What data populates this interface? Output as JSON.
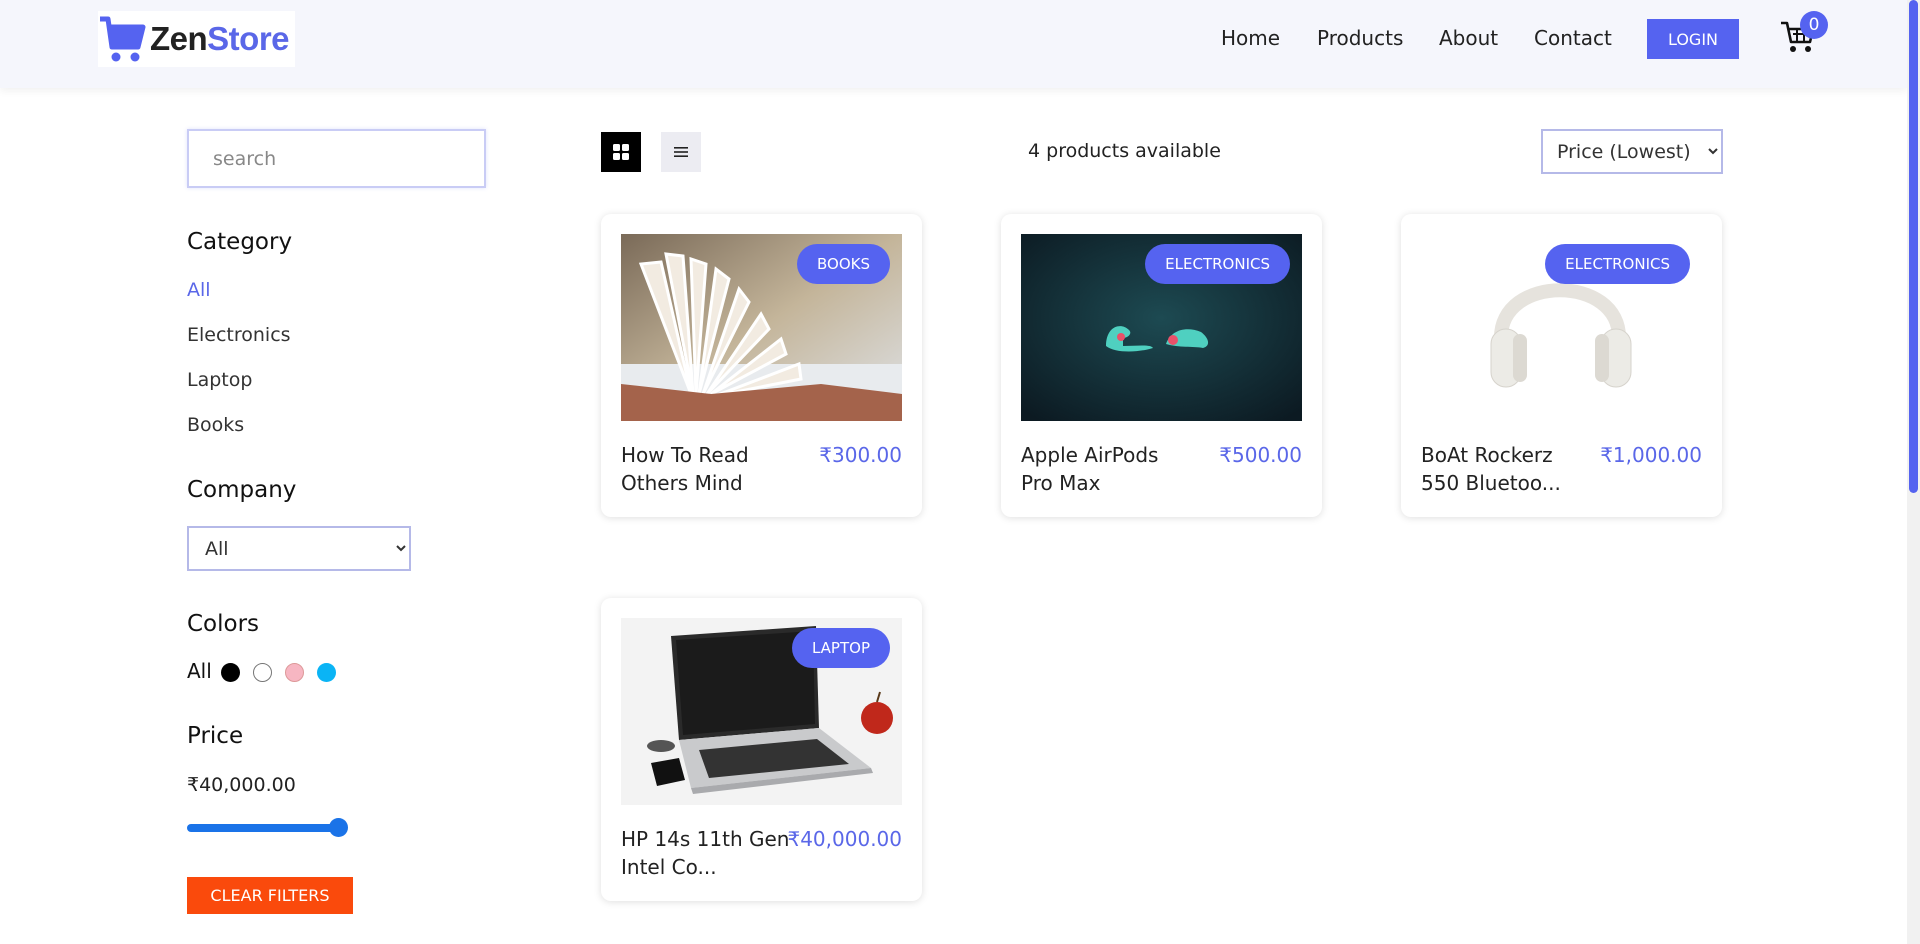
{
  "brand": {
    "name_part1": "Zen",
    "name_part2": "Store"
  },
  "nav": {
    "home": "Home",
    "products": "Products",
    "about": "About",
    "contact": "Contact",
    "login": "LOGIN",
    "cart_count": "0"
  },
  "sidebar": {
    "search_placeholder": "search",
    "category_heading": "Category",
    "categories": [
      "All",
      "Electronics",
      "Laptop",
      "Books"
    ],
    "company_heading": "Company",
    "company_selected": "All",
    "colors_heading": "Colors",
    "colors_all": "All",
    "colors": [
      "#000000",
      "#ffffff",
      "#f7b6c2",
      "#0ab4f5"
    ],
    "price_heading": "Price",
    "price_value": "₹40,000.00",
    "price_fraction": 1.0,
    "clear_filters": "CLEAR FILTERS"
  },
  "toolbar": {
    "count_text": "4 products available",
    "sort_selected": "Price (Lowest)"
  },
  "products": [
    {
      "badge": "BOOKS",
      "name": "How To Read Others Mind",
      "price": "₹300.00"
    },
    {
      "badge": "ELECTRONICS",
      "name": "Apple AirPods Pro Max",
      "price": "₹500.00"
    },
    {
      "badge": "ELECTRONICS",
      "name": "BoAt Rockerz 550 Bluetoo...",
      "price": "₹1,000.00"
    },
    {
      "badge": "LAPTOP",
      "name": "HP 14s 11th Gen Intel Co...",
      "price": "₹40,000.00"
    }
  ],
  "accent_color": "#5563f0",
  "clear_button_color": "#fa4a0c"
}
